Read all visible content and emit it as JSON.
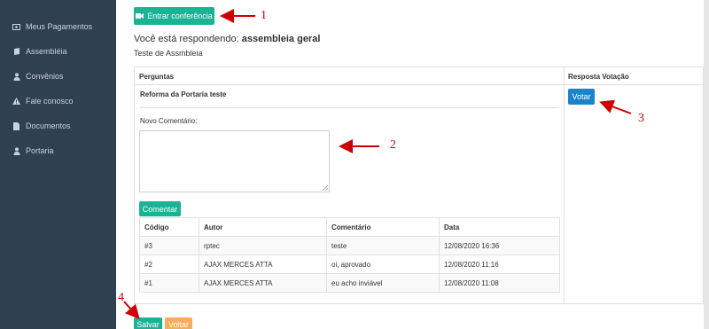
{
  "sidebar": {
    "items": [
      {
        "label": "Meus Pagamentos",
        "icon": "money-icon"
      },
      {
        "label": "Assembléia",
        "icon": "book-icon"
      },
      {
        "label": "Convênios",
        "icon": "user-icon"
      },
      {
        "label": "Fale conosco",
        "icon": "warning-icon"
      },
      {
        "label": "Documentos",
        "icon": "document-icon"
      },
      {
        "label": "Portaria",
        "icon": "user-icon"
      }
    ]
  },
  "main": {
    "conference_button": "Entrar conferência",
    "title_prefix": "Você está respondendo:",
    "title_bold": "assembleia geral",
    "subtitle": "Teste de Assmbleia",
    "table_headers": {
      "questions": "Perguntas",
      "vote": "Resposta Votação"
    },
    "question": "Reforma da Portaria teste",
    "comment_label": "Novo Comentário:",
    "comment_value": "",
    "comment_button": "Comentar",
    "vote_button": "Votar",
    "comments_table": {
      "headers": [
        "Código",
        "Autor",
        "Comentário",
        "Data"
      ],
      "rows": [
        [
          "#3",
          "rptec",
          "teste",
          "12/08/2020 16:36"
        ],
        [
          "#2",
          "AJAX MERCES ATTA",
          "oi, aprovado",
          "12/08/2020 11:16"
        ],
        [
          "#1",
          "AJAX MERCES ATTA",
          "eu acho inviável",
          "12/08/2020 11:08"
        ]
      ]
    },
    "save_button": "Salvar",
    "back_button": "Voltar"
  },
  "annotations": [
    "1",
    "2",
    "3",
    "4"
  ],
  "colors": {
    "sidebar": "#2f4050",
    "teal": "#1ab394",
    "blue": "#1c84c6",
    "orange": "#f8ac59",
    "annotation": "#cc0000"
  }
}
